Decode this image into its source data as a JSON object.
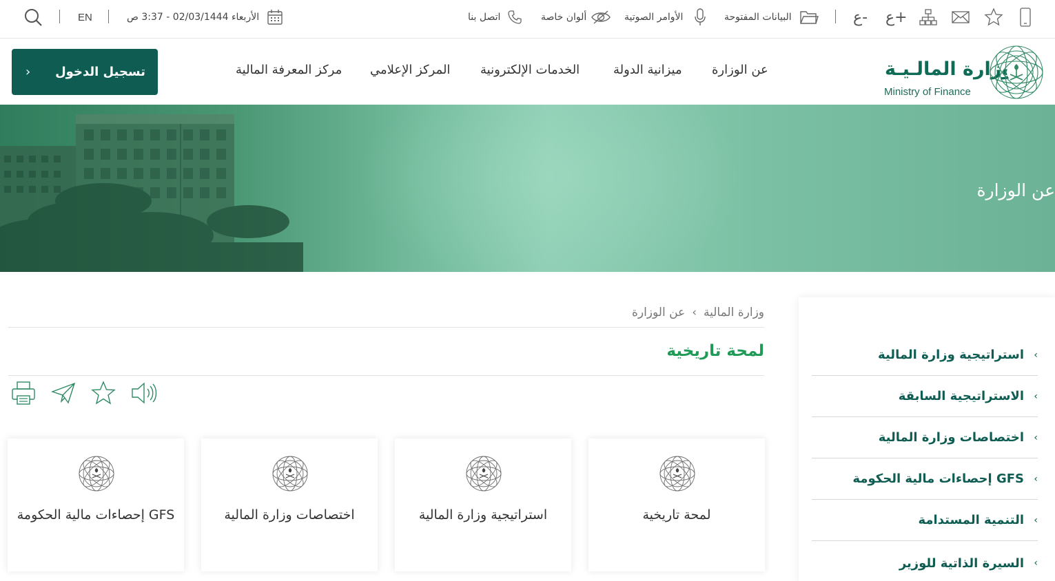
{
  "topbar": {
    "date_time": "الأربعاء 02/03/1444 - 3:37 ص",
    "lang": "EN",
    "contact": "اتصل بنا",
    "colors": "ألوان خاصة",
    "voice": "الأوامر الصوتية",
    "open_data": "البيانات المفتوحة",
    "font_decrease": "ع-",
    "font_increase": "ع+"
  },
  "header": {
    "login": "تسجيل الدخول",
    "logo_ar": "وزارة المالـيـة",
    "logo_en": "Ministry of Finance",
    "nav": [
      "عن الوزارة",
      "ميزانية الدولة",
      "الخدمات الإلكترونية",
      "المركز الإعلامي",
      "مركز المعرفة المالية"
    ]
  },
  "hero": {
    "title": "عن الوزارة"
  },
  "breadcrumb": {
    "home": "وزارة المالية",
    "current": "عن الوزارة"
  },
  "page": {
    "title": "لمحة تاريخية"
  },
  "sidebar": {
    "items": [
      "استراتيجية وزارة المالية",
      "الاستراتيجية السابقة",
      "اختصاصات وزارة المالية",
      "إحصاءات مالية الحكومة GFS",
      "التنمية المستدامة",
      "السيرة الذاتية للوزير"
    ]
  },
  "cards": [
    "لمحة تاريخية",
    "استراتيجية وزارة المالية",
    "اختصاصات وزارة المالية",
    "إحصاءات مالية الحكومة GFS"
  ],
  "colors": {
    "brand": "#0e5c52",
    "accent": "#1f9b57",
    "hero": "#7bc0a4"
  }
}
